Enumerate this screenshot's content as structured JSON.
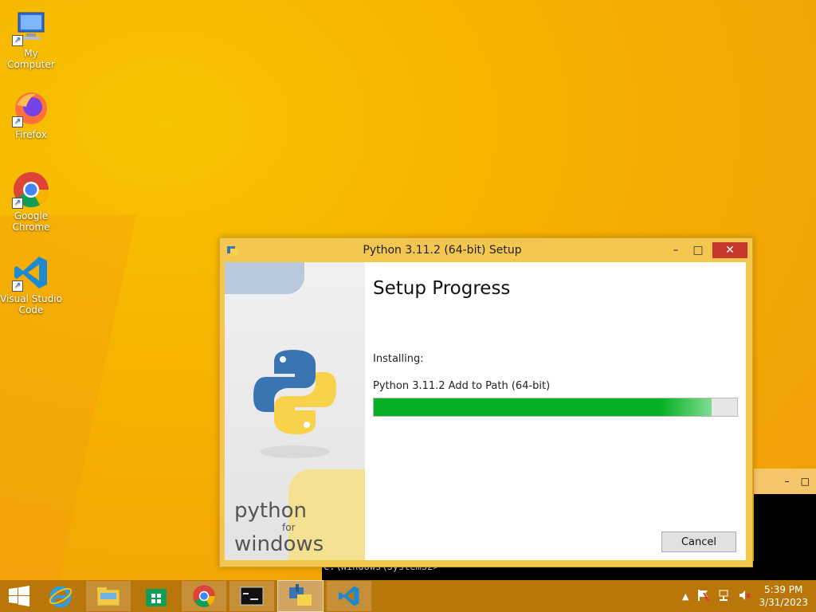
{
  "desktop": {
    "icons": [
      {
        "label": "My Computer"
      },
      {
        "label": "Firefox"
      },
      {
        "label": "Google Chrome"
      },
      {
        "label": "Visual Studio Code"
      }
    ]
  },
  "dialog": {
    "title": "Python 3.11.2 (64-bit) Setup",
    "heading": "Setup Progress",
    "installing_label": "Installing:",
    "current_item": "Python 3.11.2 Add to Path (64-bit)",
    "progress_percent": 93,
    "cancel_label": "Cancel",
    "brand_line1": "python",
    "brand_for": "for",
    "brand_line2": "windows",
    "minimize_glyph": "–",
    "maximize_glyph": "□",
    "close_glyph": "✕"
  },
  "console": {
    "visible_text": "C:\\Windows\\System32>",
    "minimize_glyph": "–",
    "maximize_glyph": "□"
  },
  "taskbar": {
    "apps": [
      {
        "icon": "internet-explorer-icon"
      },
      {
        "icon": "file-explorer-icon"
      },
      {
        "icon": "store-icon"
      },
      {
        "icon": "chrome-icon"
      },
      {
        "icon": "command-prompt-icon"
      },
      {
        "icon": "python-installer-icon"
      },
      {
        "icon": "vscode-icon"
      }
    ],
    "clock_time": "5:39 PM",
    "clock_date": "3/31/2023"
  },
  "colors": {
    "progress": "#06b025",
    "close_button": "#c7372b",
    "dialog_frame": "#f3c64f",
    "taskbar": "#b9760b"
  }
}
